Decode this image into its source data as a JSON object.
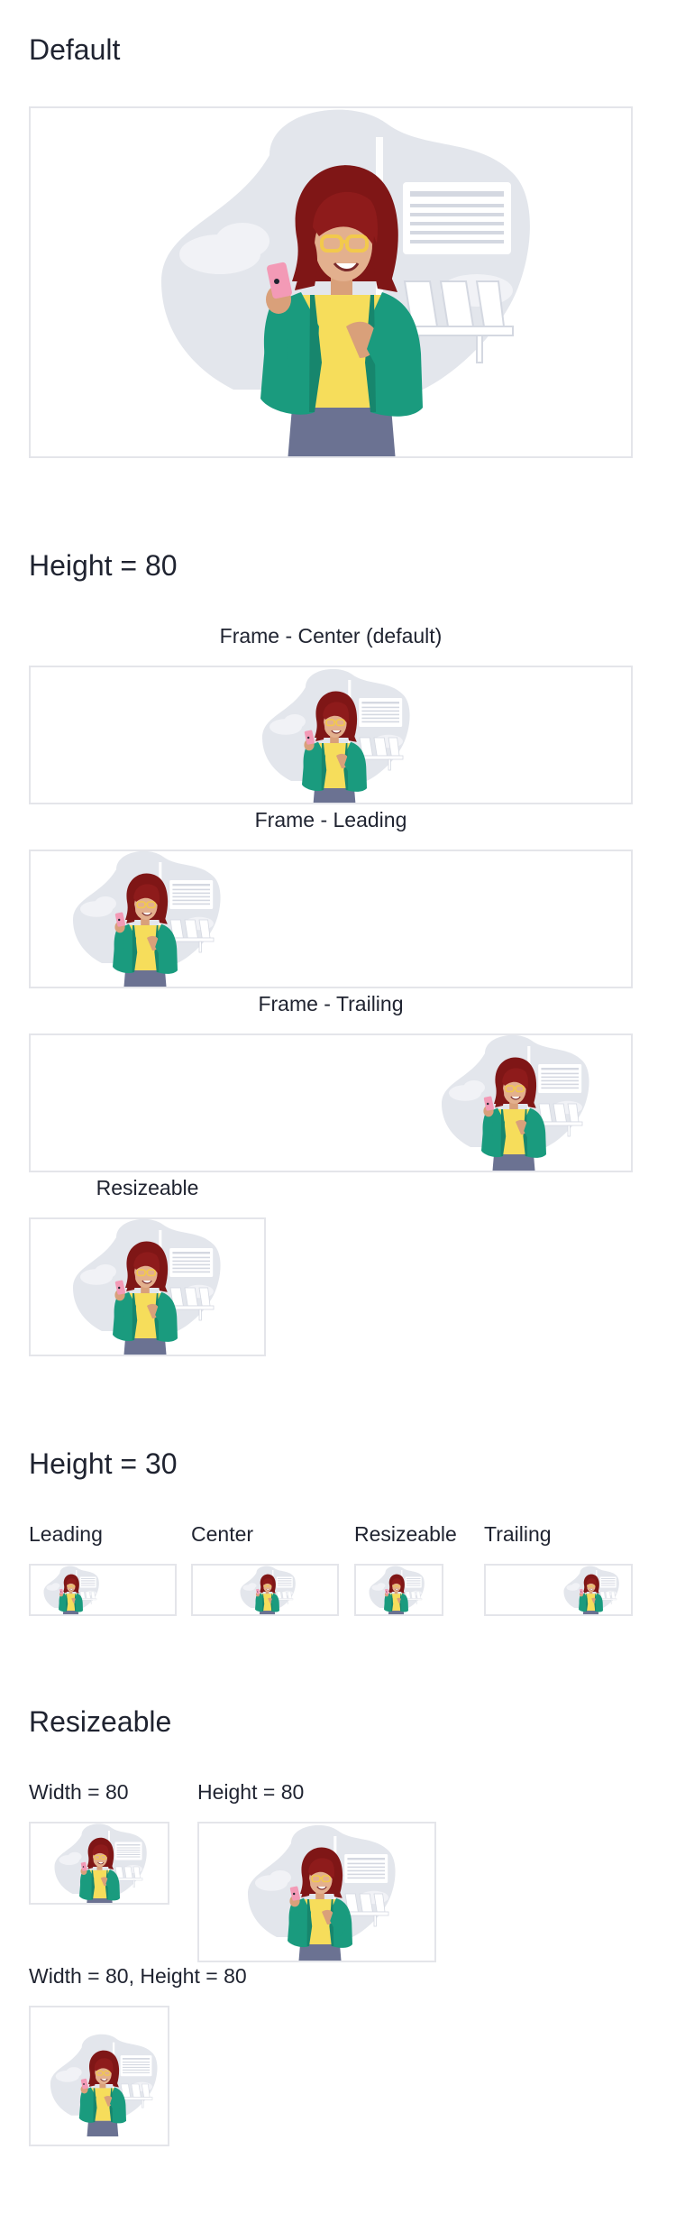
{
  "sections": {
    "default": {
      "title": "Default"
    },
    "height80": {
      "title": "Height = 80",
      "frame_center_label": "Frame - Center (default)",
      "frame_leading_label": "Frame - Leading",
      "frame_trailing_label": "Frame - Trailing",
      "resizeable_label": "Resizeable"
    },
    "height30": {
      "title": "Height = 30",
      "labels": [
        "Leading",
        "Center",
        "Resizeable",
        "Trailing"
      ]
    },
    "resizeable": {
      "title": "Resizeable",
      "width80_label": "Width = 80",
      "height80_label": "Height = 80",
      "both_label": "Width = 80, Height = 80"
    }
  },
  "illustration": {
    "name": "woman-with-phone-at-airport"
  },
  "colors": {
    "text": "#1f2330",
    "border": "#e4e5ea",
    "blob": "#e3e6ec",
    "jacket": "#1a9b7e",
    "shirt": "#f6dd5b",
    "hair": "#7f1616",
    "skin": "#d9a07a",
    "pants": "#6b7292",
    "phone": "#f39ab6"
  }
}
